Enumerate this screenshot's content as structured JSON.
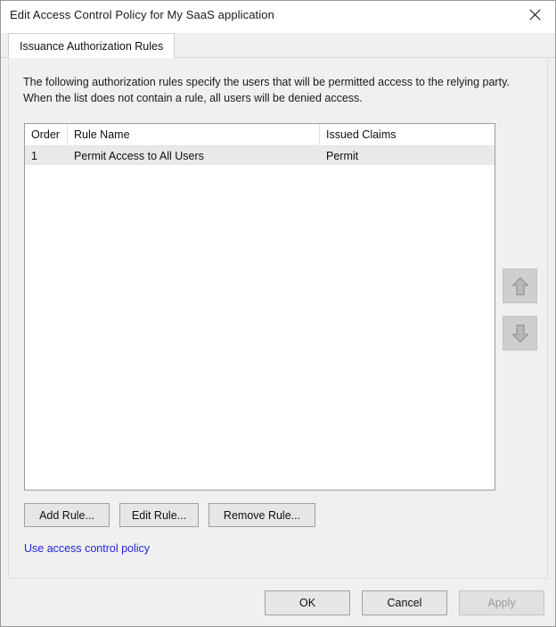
{
  "window": {
    "title": "Edit Access Control Policy for My SaaS application",
    "close_icon": "close-icon"
  },
  "tabs": [
    {
      "label": "Issuance Authorization Rules",
      "selected": true
    }
  ],
  "main": {
    "description": "The following authorization rules specify the users that will be permitted access to the relying party. When the list does not contain a rule, all users will be denied access.",
    "list": {
      "columns": [
        "Order",
        "Rule Name",
        "Issued Claims"
      ],
      "rows": [
        {
          "order": "1",
          "rule_name": "Permit Access to All Users",
          "issued_claims": "Permit"
        }
      ]
    },
    "order_buttons": {
      "move_up_icon": "arrow-up-icon",
      "move_down_icon": "arrow-down-icon",
      "enabled": false
    },
    "rule_buttons": {
      "add": "Add Rule...",
      "edit": "Edit Rule...",
      "remove": "Remove Rule..."
    },
    "policy_link": "Use access control policy"
  },
  "footer": {
    "ok": "OK",
    "cancel": "Cancel",
    "apply": "Apply",
    "apply_enabled": false
  },
  "colors": {
    "dialog_background": "#f0f0f0",
    "titlebar_background": "#ffffff",
    "link": "#2222dd",
    "selected_row": "#e9e9e9",
    "listview_border": "#9c9c9c",
    "disabled_text": "#9a9a9a"
  }
}
